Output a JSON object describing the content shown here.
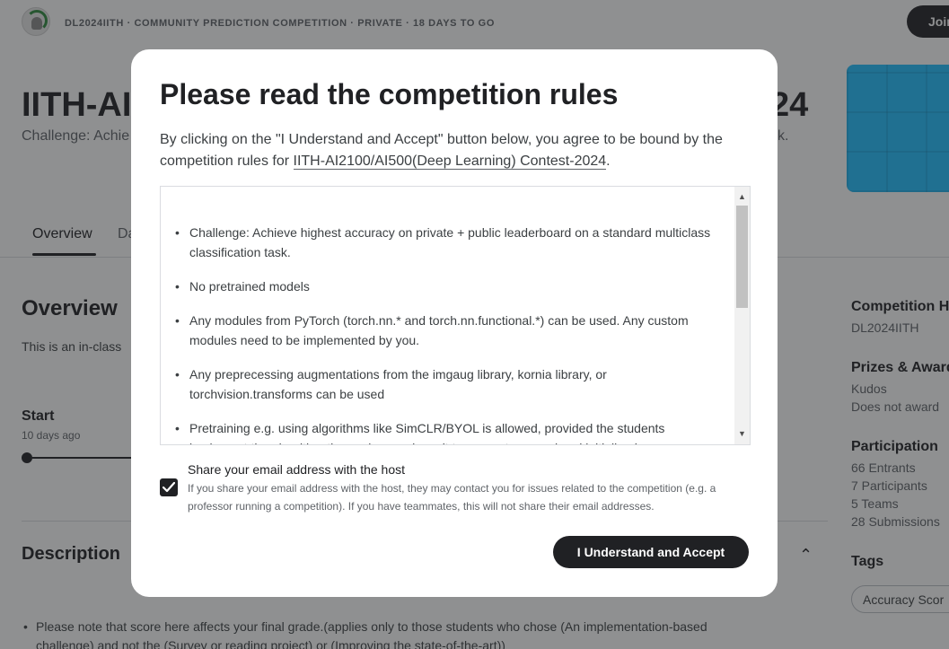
{
  "header": {
    "breadcrumb": "DL2024IITH · COMMUNITY PREDICTION COMPETITION · PRIVATE · 18 DAYS TO GO",
    "join_label": "Join"
  },
  "competition": {
    "title_start": "IITH-AI",
    "title_end": "24",
    "subtitle_start": "Challenge: Achie",
    "subtitle_end": "k."
  },
  "tabs": [
    {
      "label": "Overview"
    },
    {
      "label": "Da"
    }
  ],
  "overview": {
    "heading": "Overview",
    "text": "This is an in-class",
    "start_label": "Start",
    "start_sub": "10 days ago"
  },
  "description": {
    "heading": "Description",
    "bullet": "Please note that score here affects your final grade.(applies only to those students who chose (An implementation-based challenge) and not the (Survey or reading project) or (Improving the state-of-the-art))"
  },
  "sidebar": {
    "host_heading": "Competition H",
    "host_value": "DL2024IITH",
    "prizes_heading": "Prizes & Award",
    "prizes_values": [
      "Kudos",
      "Does not award"
    ],
    "participation_heading": "Participation",
    "participation_values": [
      "66 Entrants",
      "7 Participants",
      "5 Teams",
      "28 Submissions"
    ],
    "tags_heading": "Tags",
    "tag": "Accuracy Scor"
  },
  "modal": {
    "title": "Please read the competition rules",
    "intro_before": "By clicking on the \"I Understand and Accept\" button below, you agree to be bound by the competition rules for ",
    "intro_link": "IITH-AI2100/AI500(Deep Learning) Contest-2024",
    "intro_after": ".",
    "rules": [
      "Challenge: Achieve highest accuracy on private + public leaderboard on a standard multiclass classification task.",
      "No pretrained models",
      "Any modules from PyTorch (torch.nn.* and torch.nn.functional.*) can be used. Any custom modules need to be implemented by you.",
      "Any preprecessing augmentations from the imgaug library, kornia library, or torchvision.transforms can be used",
      "Pretraining e.g. using algorithms like SimCLR/BYOL is allowed, provided the students implement the algorithm themselves and use it to generate a good and initialized"
    ],
    "share_label": "Share your email address with the host",
    "share_checked": true,
    "share_help": "If you share your email address with the host, they may contact you for issues related to the competition (e.g. a professor running a competition). If you have teammates, this will not share their email addresses.",
    "accept_label": "I Understand and Accept"
  }
}
